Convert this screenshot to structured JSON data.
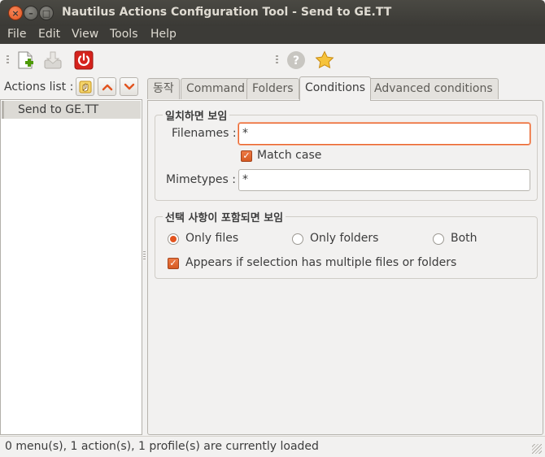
{
  "window": {
    "title": "Nautilus Actions Configuration Tool - Send to GE.TT",
    "close_glyph": "×",
    "minimize_glyph": "–",
    "maximize_glyph": "□"
  },
  "menubar": {
    "items": [
      "File",
      "Edit",
      "View",
      "Tools",
      "Help"
    ]
  },
  "toolbar": {
    "icons": [
      "new-action-icon",
      "import-icon",
      "quit-icon",
      "help-icon",
      "preferences-star-icon"
    ]
  },
  "actions": {
    "label": "Actions list :",
    "items": [
      {
        "label": "Send to GE.TT"
      }
    ]
  },
  "tabs": [
    "동작",
    "Command",
    "Folders",
    "Conditions",
    "Advanced conditions"
  ],
  "active_tab": "Conditions",
  "conditions": {
    "match_frame": {
      "title": "일치하면 보임",
      "filenames_label": "Filenames :",
      "filenames_value": "*",
      "match_case_label": "Match case",
      "match_case_checked": true,
      "mimetypes_label": "Mimetypes :",
      "mimetypes_value": "*"
    },
    "selection_frame": {
      "title": "선택 사항이 포함되면 보임",
      "options": [
        "Only files",
        "Only folders",
        "Both"
      ],
      "selected": "Only files",
      "multiple_label": "Appears if selection has multiple files or folders",
      "multiple_checked": true
    }
  },
  "status": {
    "text": "0 menu(s), 1 action(s), 1 profile(s) are currently loaded"
  },
  "colors": {
    "accent": "#e9642d",
    "titlebar": "#3c3b37",
    "selection": "#dcdad5"
  }
}
